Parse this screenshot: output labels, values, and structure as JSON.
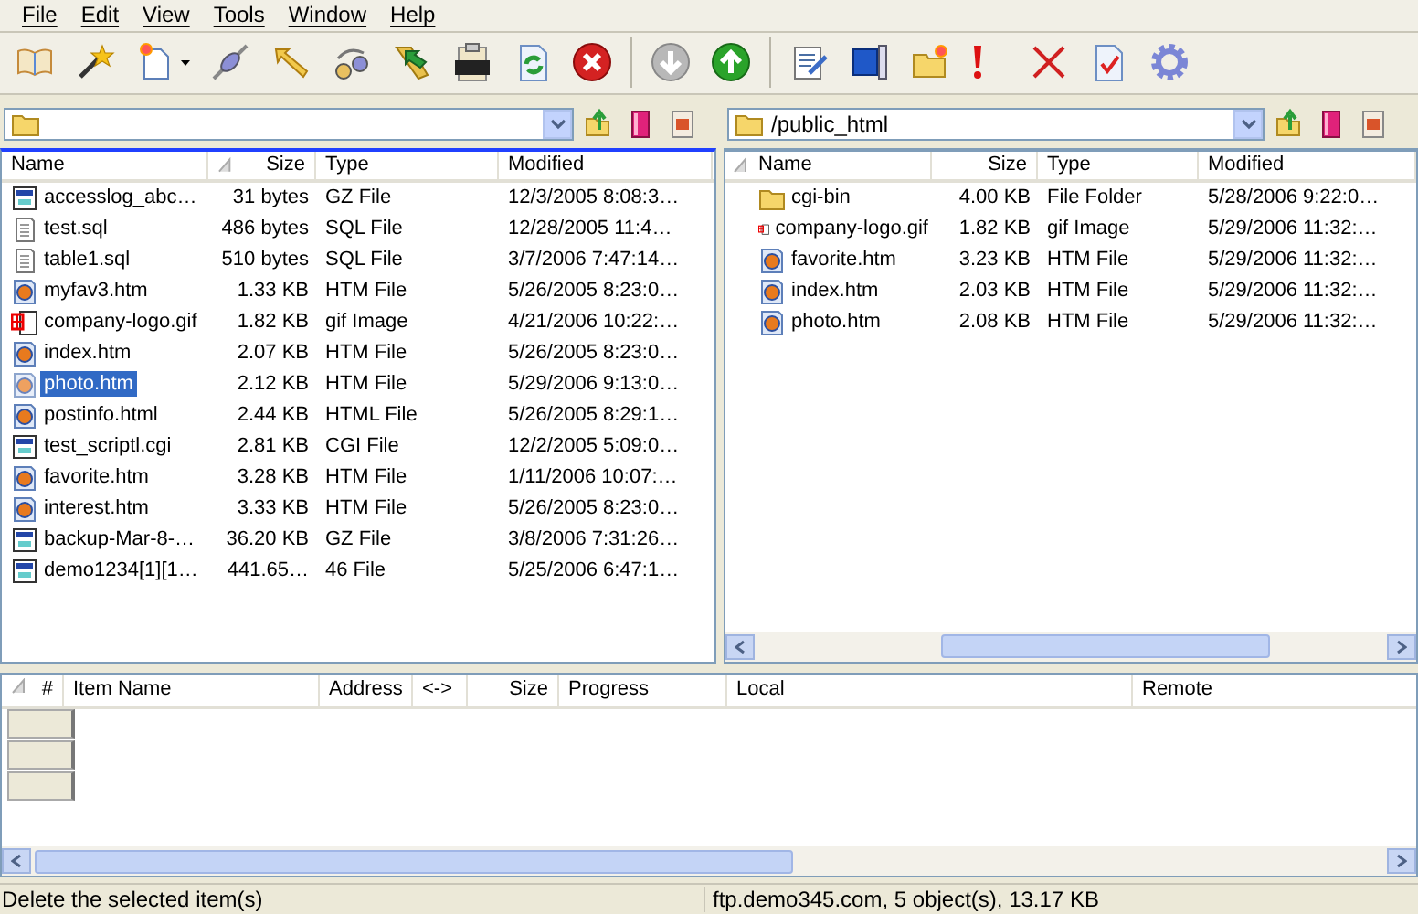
{
  "menu": [
    "File",
    "Edit",
    "View",
    "Tools",
    "Window",
    "Help"
  ],
  "local_pane": {
    "columns": [
      "Name",
      "Size",
      "Type",
      "Modified"
    ],
    "rows": [
      {
        "kind": "archive",
        "name": "accesslog_abc…",
        "size": "31 bytes",
        "type": "GZ File",
        "modified": "12/3/2005 8:08:3…",
        "selected": false
      },
      {
        "kind": "text",
        "name": "test.sql",
        "size": "486 bytes",
        "type": "SQL File",
        "modified": "12/28/2005 11:4…",
        "selected": false
      },
      {
        "kind": "text",
        "name": "table1.sql",
        "size": "510 bytes",
        "type": "SQL File",
        "modified": "3/7/2006 7:47:14…",
        "selected": false
      },
      {
        "kind": "web",
        "name": "myfav3.htm",
        "size": "1.33 KB",
        "type": "HTM File",
        "modified": "5/26/2005 8:23:0…",
        "selected": false
      },
      {
        "kind": "image",
        "name": "company-logo.gif",
        "size": "1.82 KB",
        "type": "gif Image",
        "modified": "4/21/2006 10:22:…",
        "selected": false
      },
      {
        "kind": "web",
        "name": "index.htm",
        "size": "2.07 KB",
        "type": "HTM File",
        "modified": "5/26/2005 8:23:0…",
        "selected": false
      },
      {
        "kind": "web",
        "name": "photo.htm",
        "size": "2.12 KB",
        "type": "HTM File",
        "modified": "5/29/2006 9:13:0…",
        "selected": true
      },
      {
        "kind": "web",
        "name": "postinfo.html",
        "size": "2.44 KB",
        "type": "HTML File",
        "modified": "5/26/2005 8:29:1…",
        "selected": false
      },
      {
        "kind": "archive",
        "name": "test_scriptl.cgi",
        "size": "2.81 KB",
        "type": "CGI File",
        "modified": "12/2/2005 5:09:0…",
        "selected": false
      },
      {
        "kind": "web",
        "name": "favorite.htm",
        "size": "3.28 KB",
        "type": "HTM File",
        "modified": "1/11/2006 10:07:…",
        "selected": false
      },
      {
        "kind": "web",
        "name": "interest.htm",
        "size": "3.33 KB",
        "type": "HTM File",
        "modified": "5/26/2005 8:23:0…",
        "selected": false
      },
      {
        "kind": "archive",
        "name": "backup-Mar-8-…",
        "size": "36.20 KB",
        "type": "GZ File",
        "modified": "3/8/2006 7:31:26…",
        "selected": false
      },
      {
        "kind": "archive",
        "name": "demo1234[1][1…",
        "size": "441.65…",
        "type": "46 File",
        "modified": "5/25/2006 6:47:1…",
        "selected": false
      }
    ]
  },
  "remote_pane": {
    "path": "/public_html",
    "columns": [
      "Name",
      "Size",
      "Type",
      "Modified"
    ],
    "rows": [
      {
        "kind": "folder",
        "name": "cgi-bin",
        "size": "4.00 KB",
        "type": "File Folder",
        "modified": "5/28/2006 9:22:0…",
        "selected": false
      },
      {
        "kind": "image",
        "name": "company-logo.gif",
        "size": "1.82 KB",
        "type": "gif Image",
        "modified": "5/29/2006 11:32:…",
        "selected": false
      },
      {
        "kind": "web",
        "name": "favorite.htm",
        "size": "3.23 KB",
        "type": "HTM File",
        "modified": "5/29/2006 11:32:…",
        "selected": false
      },
      {
        "kind": "web",
        "name": "index.htm",
        "size": "2.03 KB",
        "type": "HTM File",
        "modified": "5/29/2006 11:32:…",
        "selected": false
      },
      {
        "kind": "web",
        "name": "photo.htm",
        "size": "2.08 KB",
        "type": "HTM File",
        "modified": "5/29/2006 11:32:…",
        "selected": false
      }
    ]
  },
  "queue": {
    "columns": [
      "#",
      "Item Name",
      "Address",
      "<->",
      "Size",
      "Progress",
      "Local",
      "Remote"
    ]
  },
  "status_bar": {
    "message": "Delete the selected item(s)",
    "summary": "ftp.demo345.com, 5 object(s), 13.17 KB"
  }
}
